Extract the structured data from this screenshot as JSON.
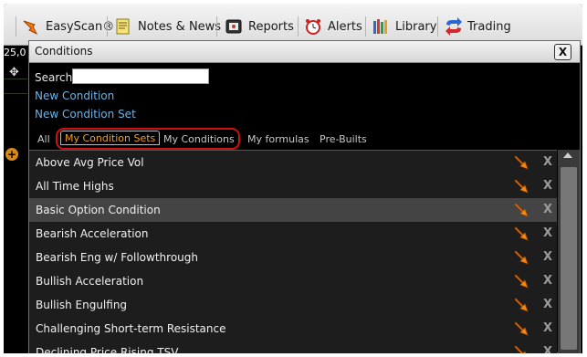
{
  "toolbar": {
    "items": [
      {
        "label": "EasyScan®",
        "icon": "easyscan-icon"
      },
      {
        "label": "Notes & News",
        "icon": "notes-icon"
      },
      {
        "label": "Reports",
        "icon": "reports-icon"
      },
      {
        "label": "Alerts",
        "icon": "alarm-clock-icon"
      },
      {
        "label": "Library",
        "icon": "library-icon"
      },
      {
        "label": "Trading",
        "icon": "trading-arrows-icon"
      }
    ]
  },
  "background": {
    "left_number": "25,0"
  },
  "dialog": {
    "title": "Conditions",
    "close_label": "X",
    "search_label": "Search",
    "search_value": "",
    "new_condition": "New Condition",
    "new_condition_set": "New Condition Set",
    "tabs": [
      {
        "label": "All",
        "active": false
      },
      {
        "label": "My Condition Sets",
        "active": true
      },
      {
        "label": "My Conditions",
        "active": false
      },
      {
        "label": "My formulas",
        "active": false
      },
      {
        "label": "Pre-Builts",
        "active": false
      }
    ],
    "rows": [
      {
        "label": "Above Avg Price Vol",
        "selected": false
      },
      {
        "label": "All Time Highs",
        "selected": false
      },
      {
        "label": "Basic Option Condition",
        "selected": true
      },
      {
        "label": "Bearish Acceleration",
        "selected": false
      },
      {
        "label": "Bearish Eng w/ Followthrough",
        "selected": false
      },
      {
        "label": "Bullish Acceleration",
        "selected": false
      },
      {
        "label": "Bullish Engulfing",
        "selected": false
      },
      {
        "label": "Challenging Short-term Resistance",
        "selected": false
      },
      {
        "label": "Declining Price Rising TSV",
        "selected": false
      }
    ],
    "row_delete_label": "X"
  },
  "colors": {
    "accent_orange": "#f0a020",
    "link_blue": "#6fb3e6",
    "highlight_red": "#d01010",
    "selected_row": "#444444"
  }
}
